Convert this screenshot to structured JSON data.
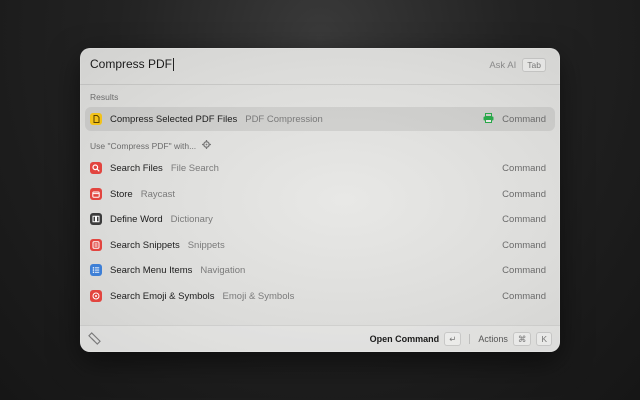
{
  "search": {
    "query": "Compress PDF",
    "ask_ai_label": "Ask AI",
    "tab_key": "Tab"
  },
  "sections": {
    "results": "Results",
    "use_with": "Use \"Compress PDF\" with..."
  },
  "results": [
    {
      "title": "Compress Selected PDF Files",
      "subtitle": "PDF Compression",
      "accessory": "Command",
      "icon": "pdf-file-icon",
      "icon_color": "#f2c21b"
    }
  ],
  "fallbacks": [
    {
      "title": "Search Files",
      "subtitle": "File Search",
      "accessory": "Command",
      "icon": "magnifier-icon",
      "icon_color": "#e2453f"
    },
    {
      "title": "Store",
      "subtitle": "Raycast",
      "accessory": "Command",
      "icon": "store-icon",
      "icon_color": "#e2453f"
    },
    {
      "title": "Define Word",
      "subtitle": "Dictionary",
      "accessory": "Command",
      "icon": "book-icon",
      "icon_color": "#3b3b3b"
    },
    {
      "title": "Search Snippets",
      "subtitle": "Snippets",
      "accessory": "Command",
      "icon": "snippet-icon",
      "icon_color": "#e2453f"
    },
    {
      "title": "Search Menu Items",
      "subtitle": "Navigation",
      "accessory": "Command",
      "icon": "menu-items-icon",
      "icon_color": "#3d7fd6"
    },
    {
      "title": "Search Emoji & Symbols",
      "subtitle": "Emoji & Symbols",
      "accessory": "Command",
      "icon": "emoji-icon",
      "icon_color": "#e2453f"
    }
  ],
  "footer": {
    "primary_action": "Open Command",
    "enter_key": "↵",
    "actions_label": "Actions",
    "cmd_key": "⌘",
    "k_key": "K"
  }
}
